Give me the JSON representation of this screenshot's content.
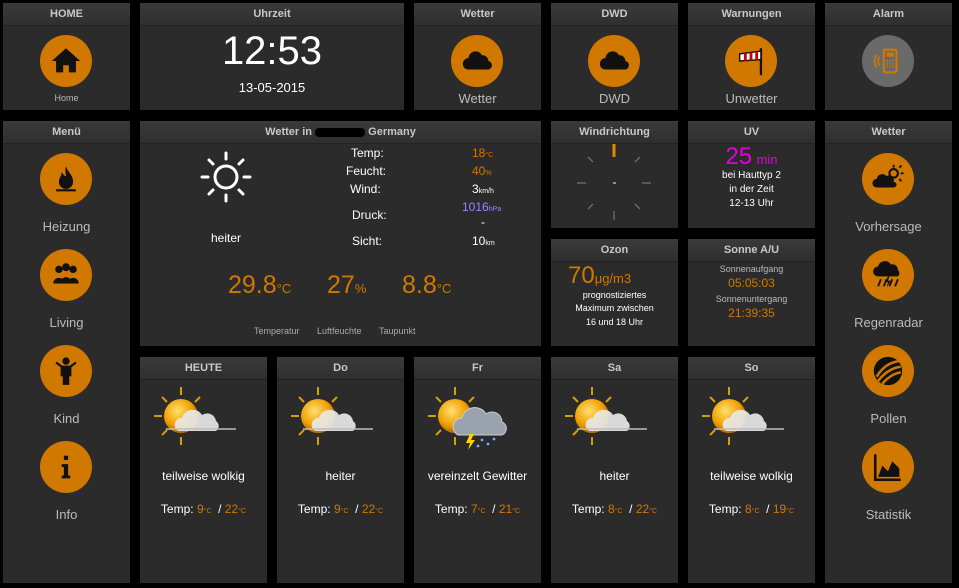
{
  "home": {
    "title": "HOME",
    "label": "Home"
  },
  "clock": {
    "title": "Uhrzeit",
    "time": "12:53",
    "date": "13-05-2015"
  },
  "wetter_top": {
    "title": "Wetter",
    "label": "Wetter"
  },
  "dwd": {
    "title": "DWD",
    "label": "DWD"
  },
  "warnungen": {
    "title": "Warnungen",
    "label": "Unwetter"
  },
  "alarm": {
    "title": "Alarm"
  },
  "menu": {
    "title": "Menü",
    "items": [
      {
        "label": "Heizung",
        "icon": "flame-icon"
      },
      {
        "label": "Living",
        "icon": "people-icon"
      },
      {
        "label": "Kind",
        "icon": "child-icon"
      },
      {
        "label": "Info",
        "icon": "info-icon"
      }
    ]
  },
  "current": {
    "title_left": "Wetter in",
    "title_right": "Germany",
    "condition": "heiter",
    "rows": [
      {
        "label": "Temp:",
        "value": "18",
        "unit": "°C"
      },
      {
        "label": "Feucht:",
        "value": "40",
        "unit": "%"
      },
      {
        "label": "Wind:",
        "value": "3",
        "unit": "km/h"
      },
      {
        "label": "Druck:",
        "value": "1016",
        "unit": "hPa",
        "sub": "-"
      },
      {
        "label": "Sicht:",
        "value": "10",
        "unit": "km"
      }
    ],
    "big": [
      {
        "value": "29.8",
        "unit": "°C",
        "caption": "Temperatur"
      },
      {
        "value": "27",
        "unit": "%",
        "caption": "Luftfeuchte"
      },
      {
        "value": "8.8",
        "unit": "°C",
        "caption": "Taupunkt"
      }
    ]
  },
  "wind": {
    "title": "Windrichtung",
    "value": "-"
  },
  "uv": {
    "title": "UV",
    "value": "25",
    "unit": "min",
    "line1": "bei Hauttyp 2",
    "line2": "in der Zeit",
    "line3": "12-13 Uhr"
  },
  "ozon": {
    "title": "Ozon",
    "value": "70",
    "unit": "μg/m3",
    "line1": "prognostiziertes",
    "line2": "Maximum zwischen",
    "line3": "16 und 18 Uhr"
  },
  "sonne": {
    "title": "Sonne A/U",
    "rise_label": "Sonnenaufgang",
    "rise": "05:05:03",
    "set_label": "Sonnenuntergang",
    "set": "21:39:35"
  },
  "forecast": [
    {
      "day": "HEUTE",
      "cond": "teilweise wolkig",
      "temp_label": "Temp:",
      "min": "9",
      "max": "22",
      "unit": "°C"
    },
    {
      "day": "Do",
      "cond": "heiter",
      "temp_label": "Temp:",
      "min": "9",
      "max": "22",
      "unit": "°C"
    },
    {
      "day": "Fr",
      "cond": "vereinzelt Gewitter",
      "temp_label": "Temp:",
      "min": "7",
      "max": "21",
      "unit": "°C"
    },
    {
      "day": "Sa",
      "cond": "heiter",
      "temp_label": "Temp:",
      "min": "8",
      "max": "22",
      "unit": "°C"
    },
    {
      "day": "So",
      "cond": "teilweise wolkig",
      "temp_label": "Temp:",
      "min": "8",
      "max": "19",
      "unit": "°C"
    }
  ],
  "right": {
    "title": "Wetter",
    "items": [
      {
        "label": "Vorhersage",
        "icon": "forecast-icon"
      },
      {
        "label": "Regenradar",
        "icon": "rain-radar-icon"
      },
      {
        "label": "Pollen",
        "icon": "pollen-icon"
      },
      {
        "label": "Statistik",
        "icon": "chart-icon"
      }
    ]
  },
  "colors": {
    "accent": "#d07800",
    "panel": "#2b2b2b",
    "uv": "#e000e0",
    "pressure": "#8c8cff"
  }
}
